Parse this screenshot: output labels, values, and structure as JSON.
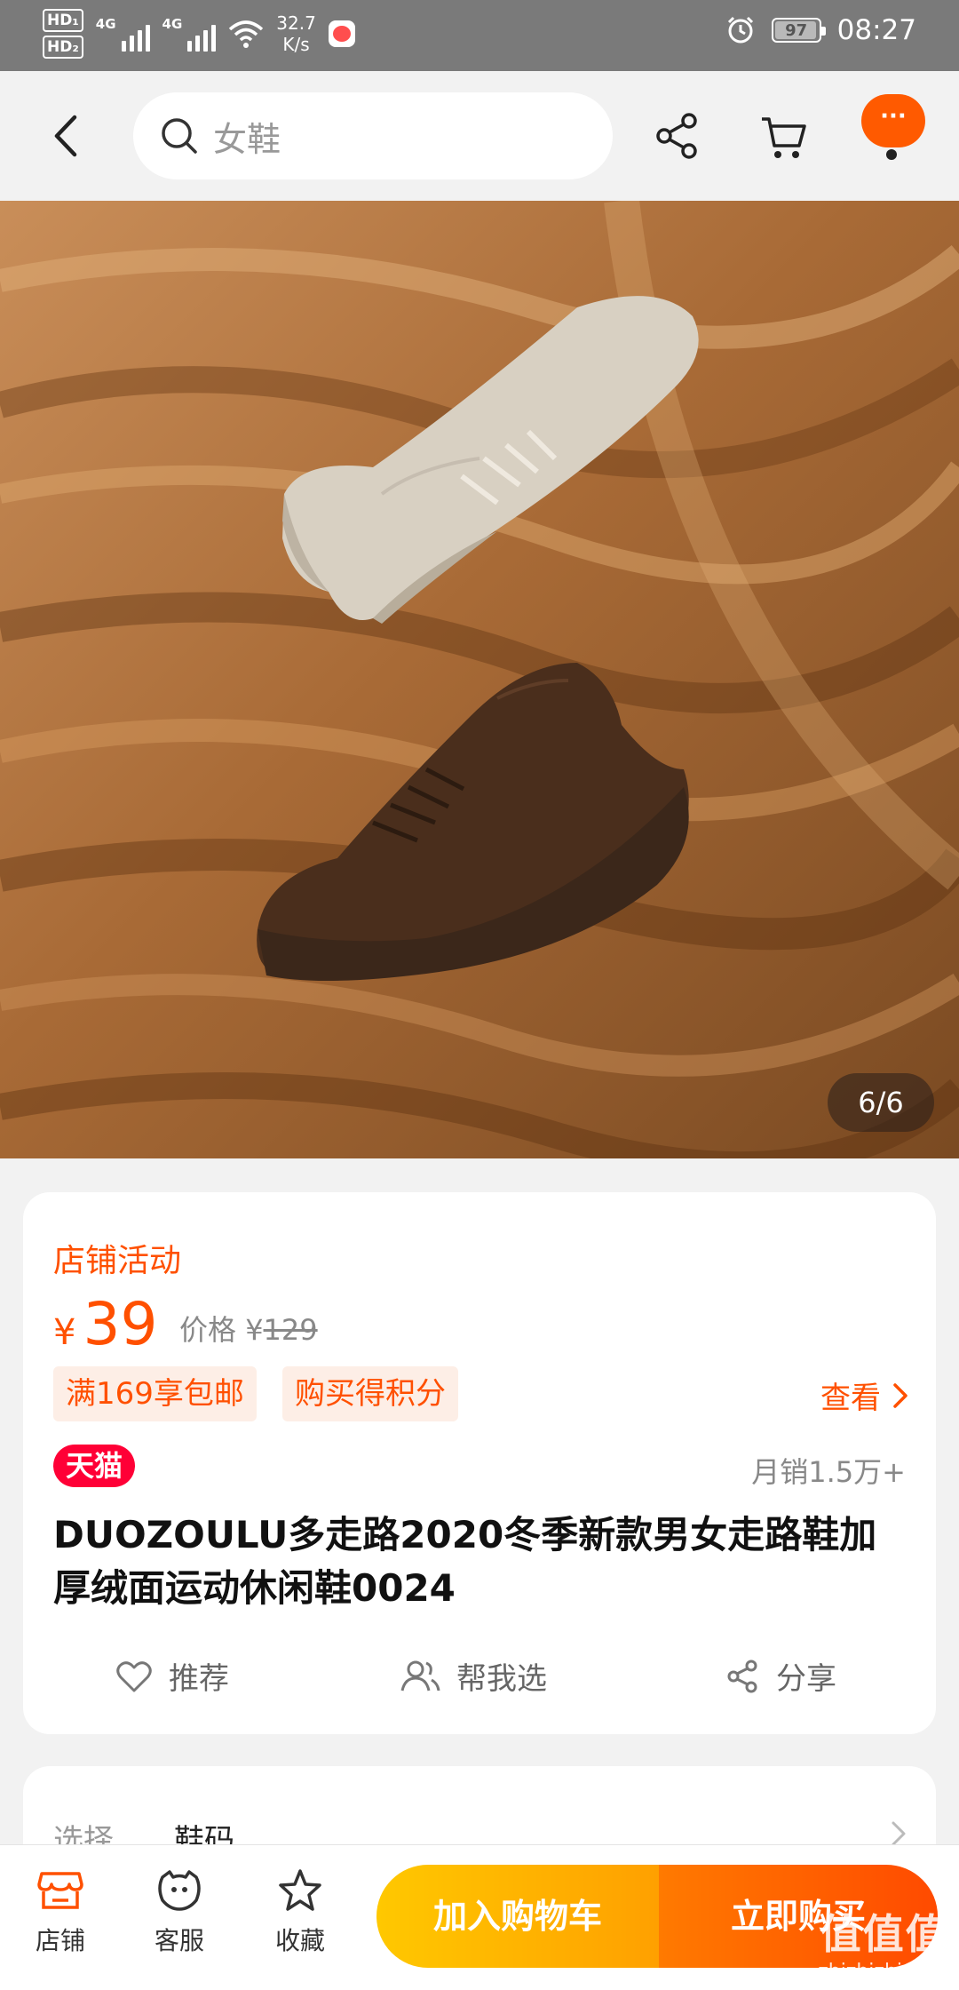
{
  "status_bar": {
    "hd1": "HD₁",
    "hd2": "HD₂",
    "net1": "4G",
    "net2": "4G",
    "speed_value": "32.7",
    "speed_unit": "K/s",
    "battery": "97",
    "battery_level": 0.97,
    "time": "08:27"
  },
  "top_nav": {
    "search_placeholder": "女鞋",
    "more_label": "···"
  },
  "gallery": {
    "counter": "6/6",
    "current": 6,
    "total": 6
  },
  "product": {
    "promo_label": "店铺活动",
    "currency": "¥",
    "price": "39",
    "original_label": "价格",
    "original_currency": "¥",
    "original_price": "129",
    "tags": [
      "满169享包邮",
      "购买得积分"
    ],
    "view_label": "查看",
    "badge": "天猫",
    "sales": "月销1.5万+",
    "title": "DUOZOULU多走路2020冬季新款男女走路鞋加厚绒面运动休闲鞋0024",
    "actions": {
      "recommend": "推荐",
      "help_choose": "帮我选",
      "share": "分享"
    }
  },
  "options": {
    "label": "选择",
    "value": "鞋码"
  },
  "bottom_bar": {
    "store": "店铺",
    "service": "客服",
    "favorite": "收藏",
    "add_to_cart": "加入购物车",
    "buy_now": "立即购买"
  },
  "watermark": {
    "logo": "值值值",
    "domain": "zhizhizhi.com"
  },
  "colors": {
    "accent": "#ff5000",
    "tmall_red": "#ff0036",
    "cart_yellow": "#ffc800",
    "buy_orange": "#ff5a00"
  },
  "icons": [
    "back-arrow-icon",
    "search-icon",
    "share-icon",
    "cart-icon",
    "more-icon",
    "heart-icon",
    "people-icon",
    "share-small-icon",
    "store-icon",
    "service-icon",
    "star-icon",
    "alarm-icon",
    "wifi-icon",
    "chevron-right-icon"
  ]
}
